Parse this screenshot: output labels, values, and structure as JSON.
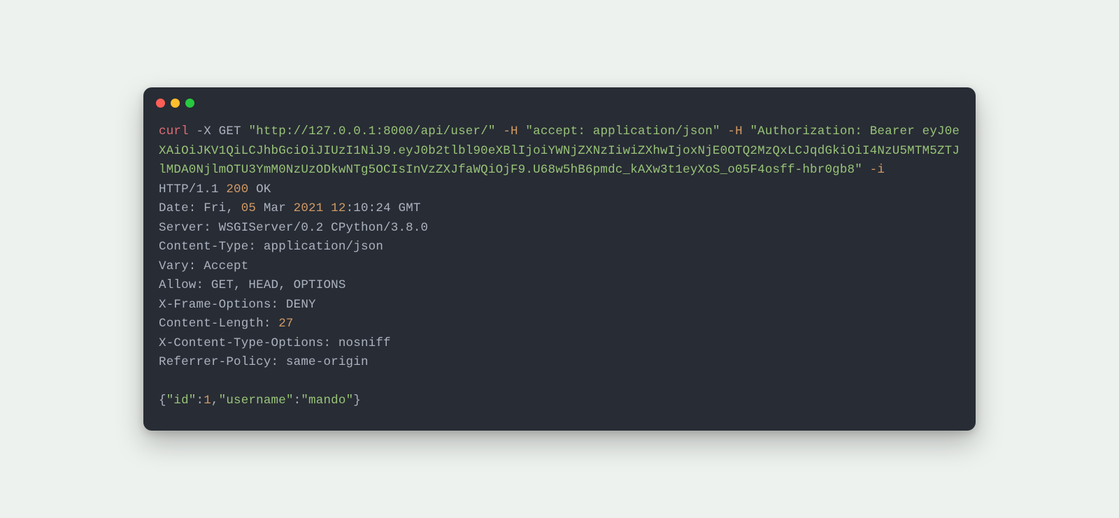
{
  "cmd": {
    "curl": "curl",
    "dashX": "-X",
    "method": "GET",
    "url": "\"http://127.0.0.1:8000/api/user/\"",
    "H1": "-H",
    "hdr1": "\"accept: application/json\"",
    "H2": "-H",
    "hdr2a": "\"Authorization: Bearer ",
    "hdr2b": "eyJ0eXAiOiJKV1QiLCJhbGciOiJIUzI1NiJ9.eyJ0b2tlbl90eXBlIjoiYWNjZXNzIiwiZXhwIjoxNjE0OTQ2MzQxLCJqdGkiOiI4NzU5MTM5ZTJlMDA0NjlmOTU3YmM0NzUzODkwNTg5OCIsInVzZXJfaWQiOjF9.U68w5hB6pmdc_kAXw3t1eyXoS_o05F4osff-hbr0gb8\"",
    "dashI": "-i"
  },
  "resp": {
    "l1a": "HTTP/1.1 ",
    "l1b": "200",
    "l1c": " OK",
    "l2a": "Date: Fri, ",
    "l2b": "05",
    "l2c": " Mar ",
    "l2d": "2021",
    "l2e": " ",
    "l2f": "12",
    "l2g": ":10:24 GMT",
    "l3": "Server: WSGIServer/0.2 CPython/3.8.0",
    "l4": "Content-Type: application/json",
    "l5": "Vary: Accept",
    "l6": "Allow: GET, HEAD, OPTIONS",
    "l7": "X-Frame-Options: DENY",
    "l8a": "Content-Length: ",
    "l8b": "27",
    "l9": "X-Content-Type-Options: nosniff",
    "l10": "Referrer-Policy: same-origin",
    "blank": "",
    "l11a": "{",
    "l11b": "\"id\"",
    "l11c": ":",
    "l11d": "1",
    "l11e": ",",
    "l11f": "\"username\"",
    "l11g": ":",
    "l11h": "\"mando\"",
    "l11i": "}"
  }
}
